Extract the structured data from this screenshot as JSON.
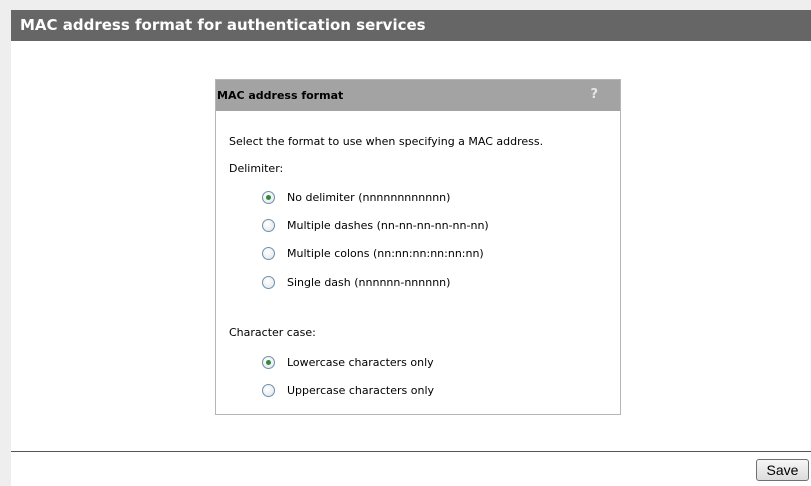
{
  "page": {
    "title": "MAC address format for authentication services"
  },
  "panel": {
    "title": "MAC address format",
    "help_icon": "?",
    "intro": "Select the format to use when specifying a MAC address.",
    "delimiter_label": "Delimiter:",
    "delimiter_options": [
      {
        "label": "No delimiter (nnnnnnnnnnnn)",
        "checked": true
      },
      {
        "label": "Multiple dashes (nn-nn-nn-nn-nn-nn)",
        "checked": false
      },
      {
        "label": "Multiple colons (nn:nn:nn:nn:nn:nn)",
        "checked": false
      },
      {
        "label": "Single dash (nnnnnn-nnnnnn)",
        "checked": false
      }
    ],
    "case_label": "Character case:",
    "case_options": [
      {
        "label": "Lowercase characters only",
        "checked": true
      },
      {
        "label": "Uppercase characters only",
        "checked": false
      }
    ]
  },
  "footer": {
    "save_label": "Save"
  },
  "colors": {
    "title_bar": "#666666",
    "panel_header": "#a3a3a3",
    "radio_checked": "#2e8b3a"
  }
}
